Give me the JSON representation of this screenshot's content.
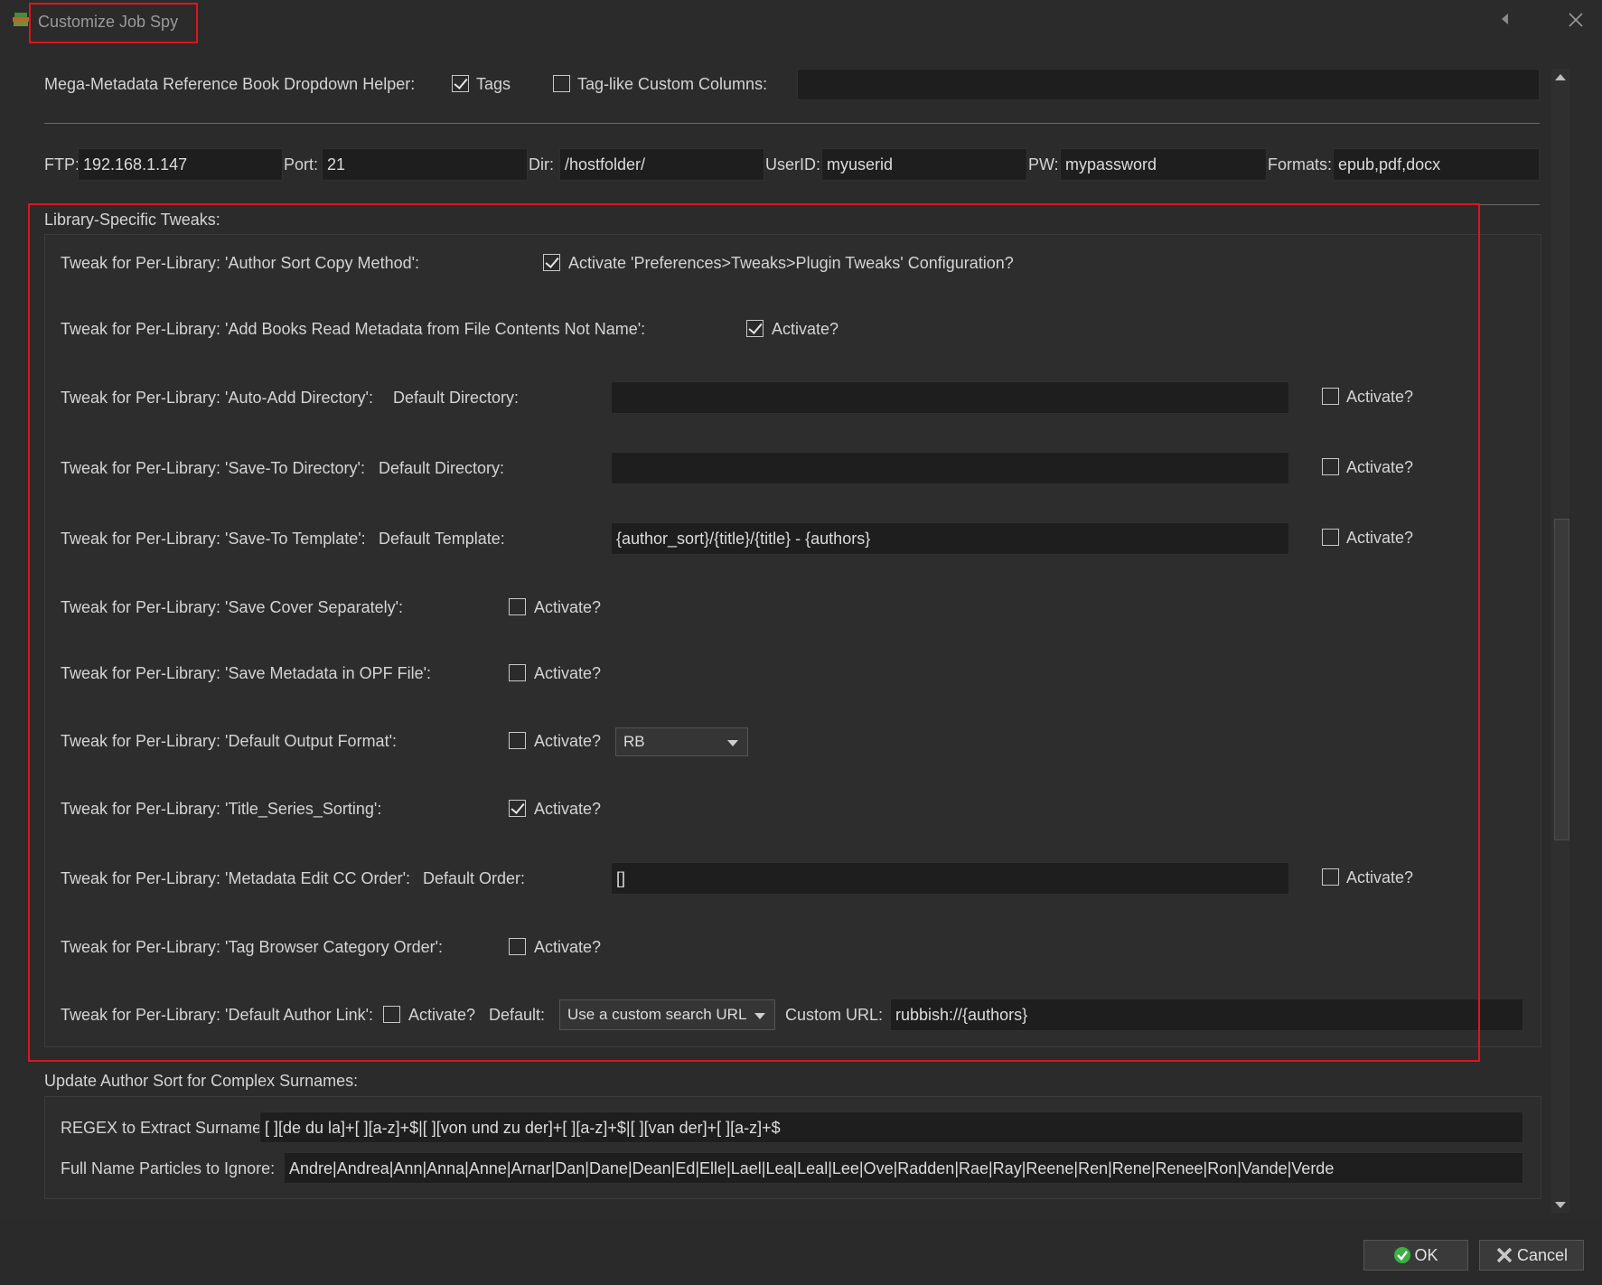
{
  "window": {
    "title": "Customize Job Spy"
  },
  "mega_helper": {
    "label": "Mega-Metadata Reference Book Dropdown Helper:",
    "tags_label": "Tags",
    "tags_checked": true,
    "tag_like_label": "Tag-like Custom Columns:",
    "tag_like_checked": false,
    "tag_like_value": ""
  },
  "ftp": {
    "ftp_label": "FTP:",
    "ftp_value": "192.168.1.147",
    "port_label": "Port:",
    "port_value": "21",
    "dir_label": "Dir:",
    "dir_value": "/hostfolder/",
    "userid_label": "UserID:",
    "userid_value": "myuserid",
    "pw_label": "PW:",
    "pw_value": "mypassword",
    "formats_label": "Formats:",
    "formats_value": "epub,pdf,docx"
  },
  "library": {
    "group_title": "Library-Specific Tweaks:",
    "author_sort": {
      "label": "Tweak for Per-Library: 'Author Sort Copy Method':",
      "activate_label": "Activate 'Preferences>Tweaks>Plugin Tweaks' Configuration?",
      "checked": true
    },
    "add_books": {
      "label": "Tweak for Per-Library: 'Add Books Read Metadata from File Contents Not Name':",
      "activate_label": "Activate?",
      "checked": true
    },
    "auto_add": {
      "label": "Tweak for Per-Library: 'Auto-Add Directory':",
      "sub_label": "Default Directory:",
      "value": "",
      "activate_label": "Activate?",
      "checked": false
    },
    "save_to_dir": {
      "label": "Tweak for Per-Library: 'Save-To Directory':",
      "sub_label": "Default Directory:",
      "value": "",
      "activate_label": "Activate?",
      "checked": false
    },
    "save_to_template": {
      "label": "Tweak for Per-Library: 'Save-To Template':",
      "sub_label": "Default Template:",
      "value": "{author_sort}/{title}/{title} - {authors}",
      "activate_label": "Activate?",
      "checked": false
    },
    "save_cover": {
      "label": "Tweak for Per-Library: 'Save Cover Separately':",
      "activate_label": "Activate?",
      "checked": false
    },
    "save_opf": {
      "label": "Tweak for Per-Library: 'Save Metadata in OPF File':",
      "activate_label": "Activate?",
      "checked": false
    },
    "output_format": {
      "label": "Tweak for Per-Library: 'Default Output Format':",
      "activate_label": "Activate?",
      "checked": false,
      "selected": "RB"
    },
    "title_series": {
      "label": "Tweak for Per-Library: 'Title_Series_Sorting':",
      "activate_label": "Activate?",
      "checked": true
    },
    "cc_order": {
      "label": "Tweak for Per-Library: 'Metadata Edit CC Order':",
      "sub_label": "Default Order:",
      "value": "[]",
      "activate_label": "Activate?",
      "checked": false
    },
    "tag_browser": {
      "label": "Tweak for Per-Library: 'Tag Browser Category Order':",
      "activate_label": "Activate?",
      "checked": false
    },
    "author_link": {
      "label": "Tweak for Per-Library: 'Default Author Link':",
      "activate_label": "Activate?",
      "checked": false,
      "default_label": "Default:",
      "selected": "Use a custom search URL",
      "custom_url_label": "Custom URL:",
      "custom_url_value": "rubbish://{authors}"
    }
  },
  "surnames": {
    "group_title": "Update Author Sort for Complex Surnames:",
    "regex_label": "REGEX to Extract Surname:",
    "regex_value": "[ ][de du la]+[ ][a-z]+$|[ ][von und zu der]+[ ][a-z]+$|[ ][van der]+[ ][a-z]+$",
    "particles_label": "Full Name Particles to Ignore:",
    "particles_value": "Andre|Andrea|Ann|Anna|Anne|Arnar|Dan|Dane|Dean|Ed|Elle|Lael|Lea|Leal|Lee|Ove|Radden|Rae|Ray|Reene|Ren|Rene|Renee|Ron|Vande|Verde"
  },
  "buttons": {
    "ok_label": "OK",
    "cancel_label": "Cancel"
  },
  "colors": {
    "background": "#2b2b2b",
    "field": "#1e1e1e",
    "highlight": "#e0141e",
    "ok_icon": "#3cb043"
  }
}
